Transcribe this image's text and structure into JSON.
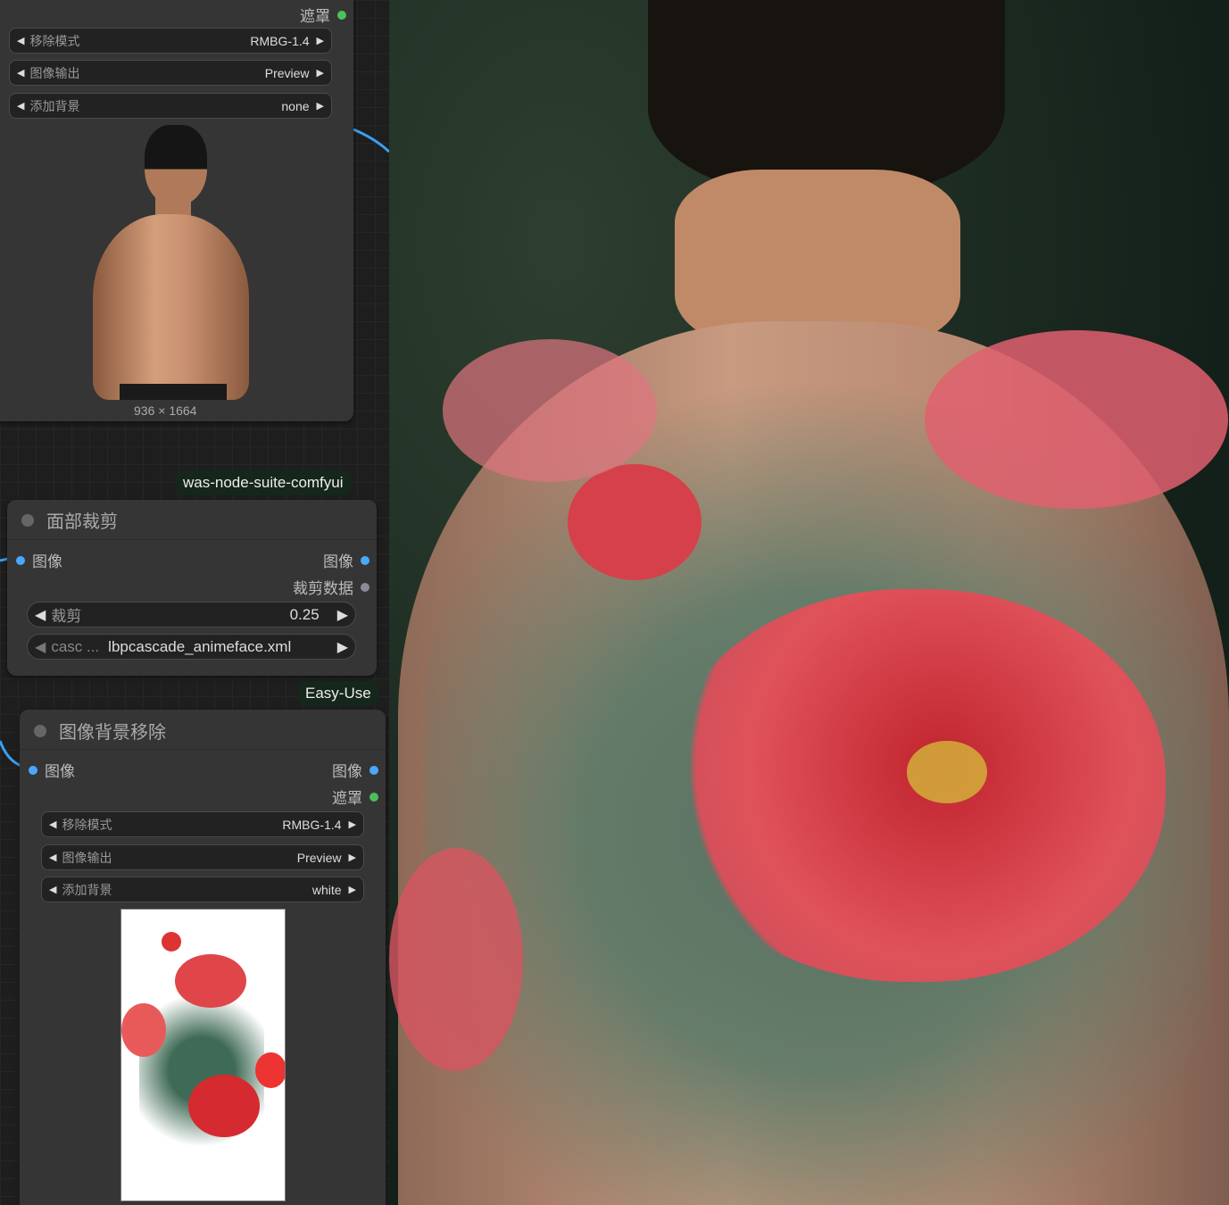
{
  "node_top": {
    "output_mask": "遮罩",
    "widgets": [
      {
        "label": "移除模式",
        "value": "RMBG-1.4"
      },
      {
        "label": "图像输出",
        "value": "Preview"
      },
      {
        "label": "添加背景",
        "value": "none"
      }
    ],
    "image_size": "936 × 1664"
  },
  "badge1": "was-node-suite-comfyui",
  "face_crop": {
    "title": "面部裁剪",
    "input_image": "图像",
    "output_image": "图像",
    "output_crop_data": "裁剪数据",
    "widgets": [
      {
        "label": "裁剪",
        "value": "0.25"
      },
      {
        "label": "casc ...",
        "value": "lbpcascade_animeface.xml"
      }
    ]
  },
  "badge2": "Easy-Use",
  "bg_remove": {
    "title": "图像背景移除",
    "input_image": "图像",
    "output_image": "图像",
    "output_mask": "遮罩",
    "widgets": [
      {
        "label": "移除模式",
        "value": "RMBG-1.4"
      },
      {
        "label": "图像输出",
        "value": "Preview"
      },
      {
        "label": "添加背景",
        "value": "white"
      }
    ]
  },
  "colors": {
    "image_slot": "#4aa8ff",
    "mask_slot": "#4cc05a",
    "data_slot": "#8a8a9a"
  }
}
